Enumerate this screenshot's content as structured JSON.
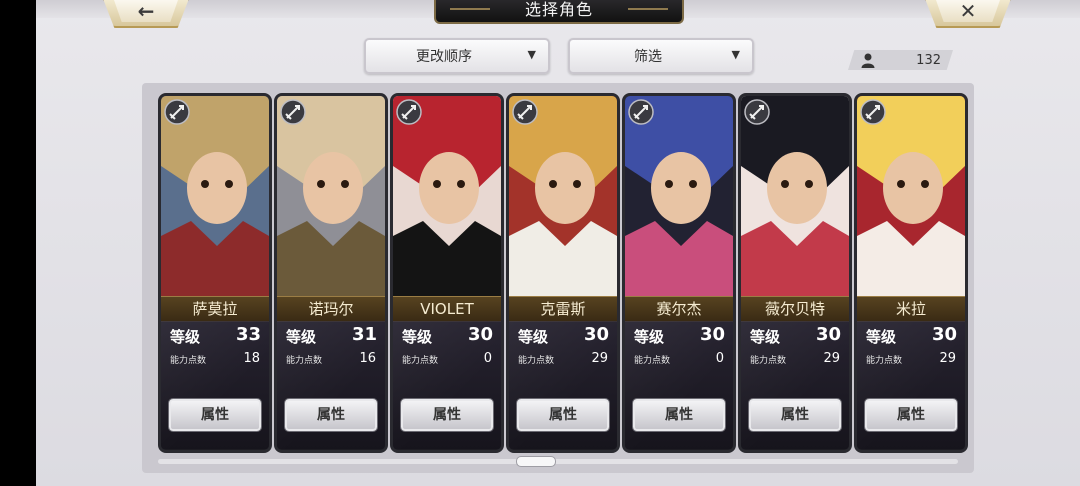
{
  "header": {
    "title": "选择角色",
    "back_icon": "←",
    "close_icon": "✕"
  },
  "controls": {
    "sort_label": "更改顺序",
    "filter_label": "筛选",
    "dropdown_arrow": "▼",
    "character_count": "132"
  },
  "cards": [
    {
      "name": "萨莫拉",
      "level_label": "等级",
      "level": "33",
      "points_label": "能力点数",
      "points": "18",
      "button_label": "属性",
      "badge_icon": "sword-badge-icon",
      "palette": [
        "#c0a36a",
        "#8d2b2b",
        "#5a6f8d"
      ]
    },
    {
      "name": "诺玛尔",
      "level_label": "等级",
      "level": "31",
      "points_label": "能力点数",
      "points": "16",
      "button_label": "属性",
      "badge_icon": "spear-badge-icon",
      "palette": [
        "#d9c4a0",
        "#6b5a3a",
        "#8f8f96"
      ]
    },
    {
      "name": "VIOLET",
      "level_label": "等级",
      "level": "30",
      "points_label": "能力点数",
      "points": "0",
      "button_label": "属性",
      "badge_icon": "sword-badge-icon",
      "palette": [
        "#b8242f",
        "#141414",
        "#e8d8d2"
      ]
    },
    {
      "name": "克雷斯",
      "level_label": "等级",
      "level": "30",
      "points_label": "能力点数",
      "points": "29",
      "button_label": "属性",
      "badge_icon": "sword-badge-icon",
      "palette": [
        "#d8a54a",
        "#f0ede6",
        "#a3332a"
      ]
    },
    {
      "name": "赛尔杰",
      "level_label": "等级",
      "level": "30",
      "points_label": "能力点数",
      "points": "0",
      "button_label": "属性",
      "badge_icon": "sword-badge-icon",
      "palette": [
        "#3e4fa5",
        "#c94e7c",
        "#222232"
      ]
    },
    {
      "name": "薇尔贝特",
      "level_label": "等级",
      "level": "30",
      "points_label": "能力点数",
      "points": "29",
      "button_label": "属性",
      "badge_icon": "sword-badge-icon",
      "palette": [
        "#1a1a22",
        "#c23a4a",
        "#efe3df"
      ]
    },
    {
      "name": "米拉",
      "level_label": "等级",
      "level": "30",
      "points_label": "能力点数",
      "points": "29",
      "button_label": "属性",
      "badge_icon": "sword-badge-icon",
      "palette": [
        "#f2cf5a",
        "#f4ece6",
        "#a8262e"
      ]
    }
  ],
  "colors": {
    "accent_gold": "#9b7d44",
    "card_bg": "#1d1c22"
  }
}
